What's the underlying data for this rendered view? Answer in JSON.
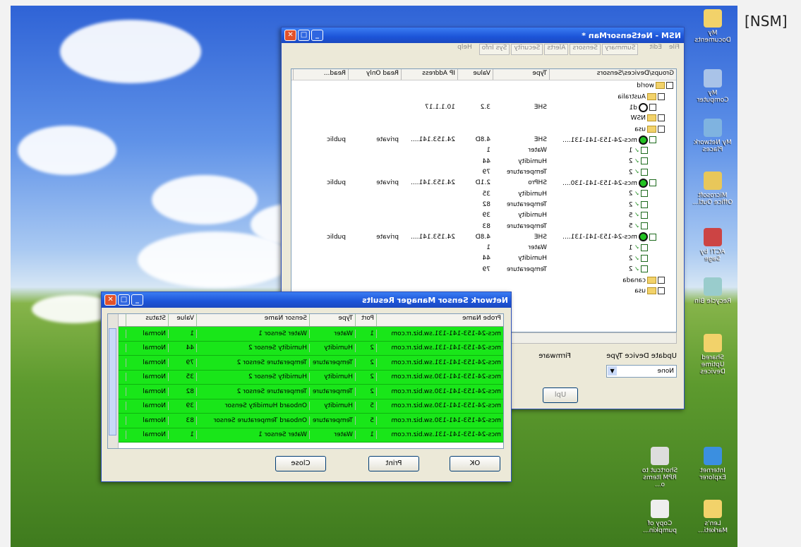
{
  "tag": "[NSM]",
  "main_window": {
    "title": "NSM - NetSensorMan *",
    "menu": [
      "File",
      "Edit",
      "Help"
    ],
    "tabs": [
      "Summary",
      "Sensors",
      "Alerts",
      "Security",
      "Sys Info"
    ],
    "columns": [
      "Groups/Devices/Sensors",
      "Type",
      "Value",
      "IP Address",
      "Read Only",
      "Read..."
    ],
    "rows": [
      {
        "indent": 0,
        "kind": "folder",
        "label": "world",
        "type": "",
        "value": "",
        "ip": "",
        "ro": "",
        "rw": ""
      },
      {
        "indent": 1,
        "kind": "folder",
        "label": "Australia",
        "type": "",
        "value": "",
        "ip": "",
        "ro": "",
        "rw": ""
      },
      {
        "indent": 2,
        "kind": "device-off",
        "label": "d1",
        "type": "SHE",
        "value": "3.2",
        "ip": "10.1.1.17",
        "ro": "",
        "rw": ""
      },
      {
        "indent": 1,
        "kind": "folder",
        "label": "NSW",
        "type": "",
        "value": "",
        "ip": "",
        "ro": "",
        "rw": ""
      },
      {
        "indent": 1,
        "kind": "folder",
        "label": "usa",
        "type": "",
        "value": "",
        "ip": "",
        "ro": "",
        "rw": ""
      },
      {
        "indent": 2,
        "kind": "device-on",
        "label": "mcs-24-153-141-131....",
        "type": "SHE",
        "value": "4.8D",
        "ip": "24.153.141....",
        "ro": "private",
        "rw": "public"
      },
      {
        "indent": 3,
        "kind": "sensor",
        "label": "1",
        "type": "Water",
        "value": "1",
        "ip": "",
        "ro": "",
        "rw": ""
      },
      {
        "indent": 3,
        "kind": "sensor",
        "label": "2",
        "type": "Humidity",
        "value": "44",
        "ip": "",
        "ro": "",
        "rw": ""
      },
      {
        "indent": 3,
        "kind": "sensor",
        "label": "2",
        "type": "Temperature",
        "value": "79",
        "ip": "",
        "ro": "",
        "rw": ""
      },
      {
        "indent": 2,
        "kind": "device-on",
        "label": "mcs-24-153-141-130....",
        "type": "SHPro",
        "value": "2.1D",
        "ip": "24.153.141....",
        "ro": "private",
        "rw": "public"
      },
      {
        "indent": 3,
        "kind": "sensor",
        "label": "2",
        "type": "Humidity",
        "value": "35",
        "ip": "",
        "ro": "",
        "rw": ""
      },
      {
        "indent": 3,
        "kind": "sensor",
        "label": "2",
        "type": "Temperature",
        "value": "82",
        "ip": "",
        "ro": "",
        "rw": ""
      },
      {
        "indent": 3,
        "kind": "sensor",
        "label": "5",
        "type": "Humidity",
        "value": "39",
        "ip": "",
        "ro": "",
        "rw": ""
      },
      {
        "indent": 3,
        "kind": "sensor",
        "label": "5",
        "type": "Temperature",
        "value": "83",
        "ip": "",
        "ro": "",
        "rw": ""
      },
      {
        "indent": 2,
        "kind": "device-on",
        "label": "mcs-24-153-141-131....",
        "type": "SHE",
        "value": "4.8D",
        "ip": "24.153.141....",
        "ro": "private",
        "rw": "public"
      },
      {
        "indent": 3,
        "kind": "sensor",
        "label": "1",
        "type": "Water",
        "value": "1",
        "ip": "",
        "ro": "",
        "rw": ""
      },
      {
        "indent": 3,
        "kind": "sensor",
        "label": "2",
        "type": "Humidity",
        "value": "44",
        "ip": "",
        "ro": "",
        "rw": ""
      },
      {
        "indent": 3,
        "kind": "sensor",
        "label": "2",
        "type": "Temperature",
        "value": "79",
        "ip": "",
        "ro": "",
        "rw": ""
      },
      {
        "indent": 1,
        "kind": "folder",
        "label": "canada",
        "type": "",
        "value": "",
        "ip": "",
        "ro": "",
        "rw": ""
      },
      {
        "indent": 1,
        "kind": "folder",
        "label": "usa",
        "type": "",
        "value": "",
        "ip": "",
        "ro": "",
        "rw": ""
      }
    ],
    "update_label": "Update Device Type",
    "update_value": "None",
    "firmware_label": "Firmware",
    "upload_label": "Upl"
  },
  "results_window": {
    "title": "Network Sensor Manager Results",
    "columns": [
      "Probe Name",
      "Port",
      "Type",
      "Sensor Name",
      "Value",
      "Status"
    ],
    "rows": [
      [
        "mcs-24-153-141-131.sw.biz.rr.com",
        "1",
        "Water",
        "Water Sensor 1",
        "1",
        "Normal"
      ],
      [
        "mcs-24-153-141-131.sw.biz.rr.com",
        "2",
        "Humidity",
        "Humidity Sensor 2",
        "44",
        "Normal"
      ],
      [
        "mcs-24-153-141-131.sw.biz.rr.com",
        "2",
        "Temperature",
        "Temperature Sensor 2",
        "79",
        "Normal"
      ],
      [
        "mcs-24-153-141-130.sw.biz.rr.com",
        "2",
        "Humidity",
        "Humidity Sensor 2",
        "35",
        "Normal"
      ],
      [
        "mcs-24-153-141-130.sw.biz.rr.com",
        "2",
        "Temperature",
        "Temperature Sensor 2",
        "82",
        "Normal"
      ],
      [
        "mcs-24-153-141-130.sw.biz.rr.com",
        "5",
        "Humidity",
        "Onboard Humidity Sensor",
        "39",
        "Normal"
      ],
      [
        "mcs-24-153-141-130.sw.biz.rr.com",
        "5",
        "Temperature",
        "Onboard Temperature Sensor",
        "83",
        "Normal"
      ],
      [
        "mcs-24-153-141-131.sw.biz.rr.com",
        "1",
        "Water",
        "Water Sensor 1",
        "1",
        "Normal"
      ]
    ],
    "buttons": {
      "ok": "OK",
      "print": "Print",
      "close": "Close"
    }
  },
  "desktop_icons": [
    {
      "label": "My Documents",
      "icon": "folder-icon"
    },
    {
      "label": "My Computer",
      "icon": "computer-icon"
    },
    {
      "label": "My Network Places",
      "icon": "network-icon"
    },
    {
      "label": "Microsoft Office Outl...",
      "icon": "outlook-icon"
    },
    {
      "label": "ACT! by Sage",
      "icon": "act-icon"
    },
    {
      "label": "Recycle Bin",
      "icon": "recycle-bin-icon"
    },
    {
      "label": "Shared Uptime Devices",
      "icon": "folder-icon"
    },
    {
      "label": "Internet Explorer",
      "icon": "ie-icon"
    },
    {
      "label": "Shortcut to RPM Items o...",
      "icon": "shortcut-icon"
    },
    {
      "label": "Len's Marketi...",
      "icon": "folder-icon"
    },
    {
      "label": "Copy of pumpkin...",
      "icon": "document-icon"
    }
  ],
  "colors": {
    "grid_row": "#19e619",
    "title_bar": "#1c54d8",
    "window_bg": "#ece9d8"
  }
}
